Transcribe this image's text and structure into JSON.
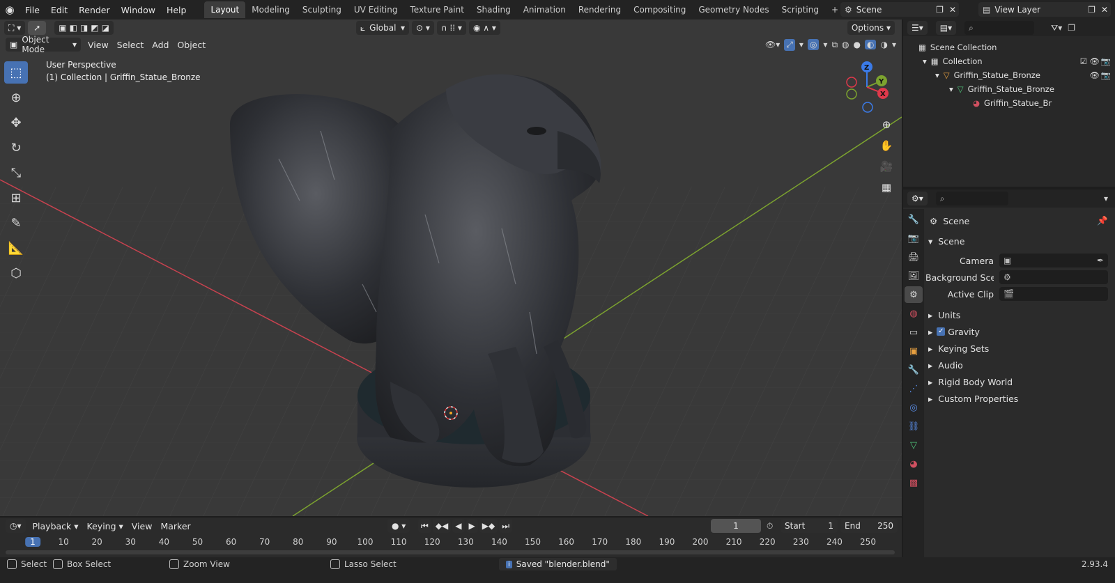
{
  "menu": {
    "items": [
      "File",
      "Edit",
      "Render",
      "Window",
      "Help"
    ]
  },
  "workspaces": {
    "active_index": 0,
    "tabs": [
      "Layout",
      "Modeling",
      "Sculpting",
      "UV Editing",
      "Texture Paint",
      "Shading",
      "Animation",
      "Rendering",
      "Compositing",
      "Geometry Nodes",
      "Scripting"
    ]
  },
  "scene": {
    "name": "Scene"
  },
  "view_layer": {
    "name": "View Layer"
  },
  "viewport": {
    "mode": "Object Mode",
    "menus": [
      "View",
      "Select",
      "Add",
      "Object"
    ],
    "orientation": "Global",
    "options_label": "Options",
    "info_line1": "User Perspective",
    "info_line2": "(1) Collection | Griffin_Statue_Bronze",
    "gizmo": {
      "z": "Z",
      "y": "Y",
      "x": "X"
    }
  },
  "outliner": {
    "root": "Scene Collection",
    "collection": "Collection",
    "object": "Griffin_Statue_Bronze",
    "mesh": "Griffin_Statue_Bronze",
    "material": "Griffin_Statue_Br"
  },
  "properties": {
    "context": "Scene",
    "panel": "Scene",
    "fields": [
      {
        "label": "Camera",
        "value": ""
      },
      {
        "label": "Background Sce...",
        "value": ""
      },
      {
        "label": "Active Clip",
        "value": ""
      }
    ],
    "collapsed_panels": [
      "Units",
      "Gravity",
      "Keying Sets",
      "Audio",
      "Rigid Body World",
      "Custom Properties"
    ],
    "gravity_checked": true
  },
  "timeline": {
    "menus": [
      "Playback",
      "Keying",
      "View",
      "Marker"
    ],
    "current_frame": "1",
    "start_label": "Start",
    "start": "1",
    "end_label": "End",
    "end": "250",
    "ruler": [
      "1",
      "10",
      "20",
      "30",
      "40",
      "50",
      "60",
      "70",
      "80",
      "90",
      "100",
      "110",
      "120",
      "130",
      "140",
      "150",
      "160",
      "170",
      "180",
      "190",
      "200",
      "210",
      "220",
      "230",
      "240",
      "250"
    ]
  },
  "status": {
    "select": "Select",
    "box_select": "Box Select",
    "zoom_view": "Zoom View",
    "lasso_select": "Lasso Select",
    "message": "Saved \"blender.blend\"",
    "version": "2.93.4"
  },
  "colors": {
    "accent": "#4772b3",
    "x_axis": "#e0394b",
    "y_axis": "#7ca32f",
    "z_axis": "#3b7be8"
  }
}
